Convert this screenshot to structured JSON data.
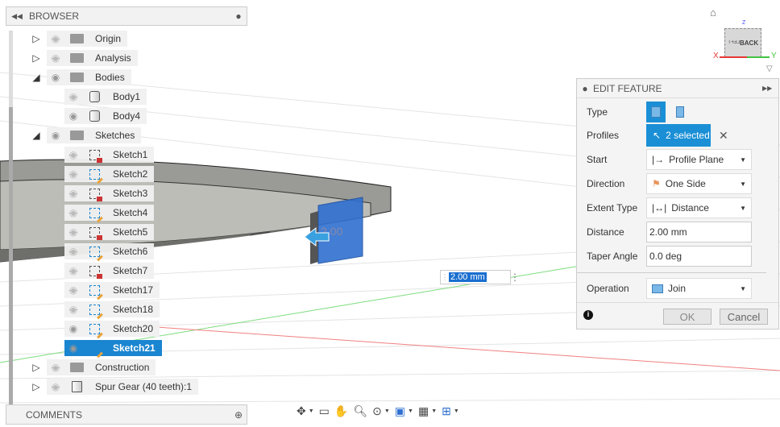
{
  "browser": {
    "title": "BROWSER",
    "items": [
      {
        "label": "Origin",
        "type": "folder",
        "expand": "closed",
        "visible": false,
        "indent": 0
      },
      {
        "label": "Analysis",
        "type": "folder",
        "expand": "closed",
        "visible": false,
        "indent": 0
      },
      {
        "label": "Bodies",
        "type": "folder",
        "expand": "open",
        "visible": true,
        "indent": 0
      },
      {
        "label": "Body1",
        "type": "body",
        "visible": false,
        "indent": 1
      },
      {
        "label": "Body4",
        "type": "body",
        "visible": true,
        "indent": 1
      },
      {
        "label": "Sketches",
        "type": "folder",
        "expand": "open",
        "visible": true,
        "indent": 0
      },
      {
        "label": "Sketch1",
        "type": "sketch-locked",
        "visible": false,
        "indent": 1
      },
      {
        "label": "Sketch2",
        "type": "sketch",
        "visible": false,
        "indent": 1
      },
      {
        "label": "Sketch3",
        "type": "sketch-locked",
        "visible": false,
        "indent": 1
      },
      {
        "label": "Sketch4",
        "type": "sketch",
        "visible": false,
        "indent": 1
      },
      {
        "label": "Sketch5",
        "type": "sketch-locked",
        "visible": false,
        "indent": 1
      },
      {
        "label": "Sketch6",
        "type": "sketch",
        "visible": false,
        "indent": 1
      },
      {
        "label": "Sketch7",
        "type": "sketch-locked",
        "visible": false,
        "indent": 1
      },
      {
        "label": "Sketch17",
        "type": "sketch",
        "visible": false,
        "indent": 1
      },
      {
        "label": "Sketch18",
        "type": "sketch",
        "visible": false,
        "indent": 1
      },
      {
        "label": "Sketch20",
        "type": "sketch",
        "visible": true,
        "indent": 1
      },
      {
        "label": "Sketch21",
        "type": "sketch",
        "visible": true,
        "indent": 1,
        "selected": true
      },
      {
        "label": "Construction",
        "type": "folder",
        "expand": "closed",
        "visible": false,
        "indent": 0
      },
      {
        "label": "Spur Gear (40 teeth):1",
        "type": "component",
        "expand": "closed",
        "visible": false,
        "indent": 0
      }
    ]
  },
  "comments": {
    "title": "COMMENTS"
  },
  "viewcube": {
    "face_back": "BACK",
    "face_left": "LEFT",
    "axis_x": "X",
    "axis_y": "Y",
    "axis_z": "Z"
  },
  "dimension_input": {
    "value": "2.00 mm"
  },
  "canvas_label": "2.00",
  "feature": {
    "title": "EDIT FEATURE",
    "type_label": "Type",
    "profiles_label": "Profiles",
    "profiles_value": "2 selected",
    "start_label": "Start",
    "start_value": "Profile Plane",
    "direction_label": "Direction",
    "direction_value": "One Side",
    "extent_label": "Extent Type",
    "extent_value": "Distance",
    "distance_label": "Distance",
    "distance_value": "2.00 mm",
    "taper_label": "Taper Angle",
    "taper_value": "0.0 deg",
    "operation_label": "Operation",
    "operation_value": "Join",
    "ok": "OK",
    "cancel": "Cancel"
  },
  "colors": {
    "accent": "#1a8fd6",
    "x_axis": "#e53935",
    "y_axis": "#43c443"
  }
}
